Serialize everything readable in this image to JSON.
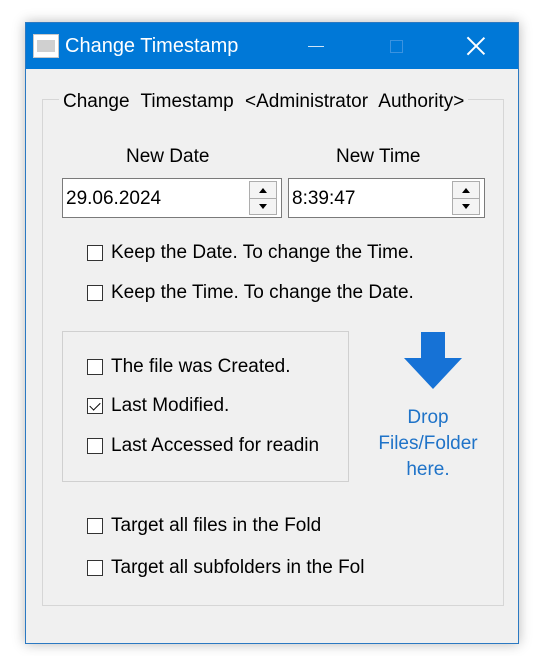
{
  "window": {
    "title": "Change Timestamp",
    "title_bar_color": "#0078d7",
    "app_icon": "window-app-icon",
    "controls": [
      "minimize",
      "maximize",
      "close"
    ]
  },
  "group": {
    "legend": "Change Timestamp <Administrator Authority>"
  },
  "date_time": {
    "date_label": "New Date",
    "time_label": "New Time",
    "date_value": "29.06.2024",
    "time_value": "8:39:47"
  },
  "keep_options": [
    {
      "label": "Keep the Date. To change the Time.",
      "checked": false
    },
    {
      "label": "Keep the Time. To change the Date.",
      "checked": false
    }
  ],
  "timestamp_types": [
    {
      "label": "The file was Created.",
      "checked": false
    },
    {
      "label": "Last Modified.",
      "checked": true
    },
    {
      "label": "Last Accessed for readin",
      "checked": false
    }
  ],
  "drop_zone": {
    "icon": "arrow-down-icon",
    "line1": "Drop",
    "line2": "Files/Folder",
    "line3": "here.",
    "accent_color": "#1f73c8"
  },
  "targets": [
    {
      "label": "Target all files in the Fold",
      "checked": false
    },
    {
      "label": "Target all subfolders in the Fol",
      "checked": false
    }
  ]
}
